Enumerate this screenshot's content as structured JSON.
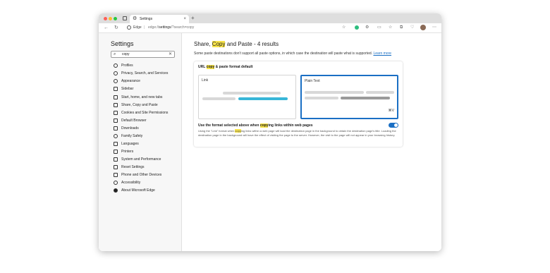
{
  "browser": {
    "tab_title": "Settings",
    "tab_close": "×",
    "new_tab": "+",
    "address_app": "Edge",
    "address_sep": "|",
    "address_scheme": "edge://",
    "address_host": "settings",
    "address_path": "/?search=copy"
  },
  "sidebar": {
    "title": "Settings",
    "search_value": "copy",
    "search_icon": "⌕",
    "search_clear": "✕",
    "items": [
      {
        "label": "Profiles"
      },
      {
        "label": "Privacy, Search, and Services"
      },
      {
        "label": "Appearance"
      },
      {
        "label": "Sidebar"
      },
      {
        "label": "Start, home, and new tabs"
      },
      {
        "label": "Share, Copy and Paste"
      },
      {
        "label": "Cookies and Site Permissions"
      },
      {
        "label": "Default Browser"
      },
      {
        "label": "Downloads"
      },
      {
        "label": "Family Safety"
      },
      {
        "label": "Languages"
      },
      {
        "label": "Printers"
      },
      {
        "label": "System and Performance"
      },
      {
        "label": "Reset Settings"
      },
      {
        "label": "Phone and Other Devices"
      },
      {
        "label": "Accessibility"
      },
      {
        "label": "About Microsoft Edge"
      }
    ]
  },
  "main": {
    "heading_pre": "Share, ",
    "heading_mark": "Copy",
    "heading_post": " and Paste - 4 results",
    "description": "Some paste destinations don't support all paste options, in which case the destination will paste what is supported.",
    "learn_more": "Learn more",
    "card": {
      "title_pre": "URL ",
      "title_mark": "copy",
      "title_post": " & paste format default",
      "option_link": "Link",
      "option_plain": "Plain Text",
      "shortcut": "⌘V",
      "setting_pre": "Use the format selected above when ",
      "setting_mark": "copy",
      "setting_post": "ing links within web pages",
      "setting_desc_pre": "Using the \"Link\" format when ",
      "setting_desc_mark": "copy",
      "setting_desc_post": "ing links within a web page will load the destination page in the background to obtain the destination page's title. Loading the destination page in the background will have the effect of visiting the page to the server. However, the visit to the page will not appear in your browsing history.",
      "toggle_on": true
    }
  },
  "colors": {
    "accent": "#1a6fc4",
    "highlight": "#f7e34a",
    "link_preview_blue": "#38b6d8"
  }
}
